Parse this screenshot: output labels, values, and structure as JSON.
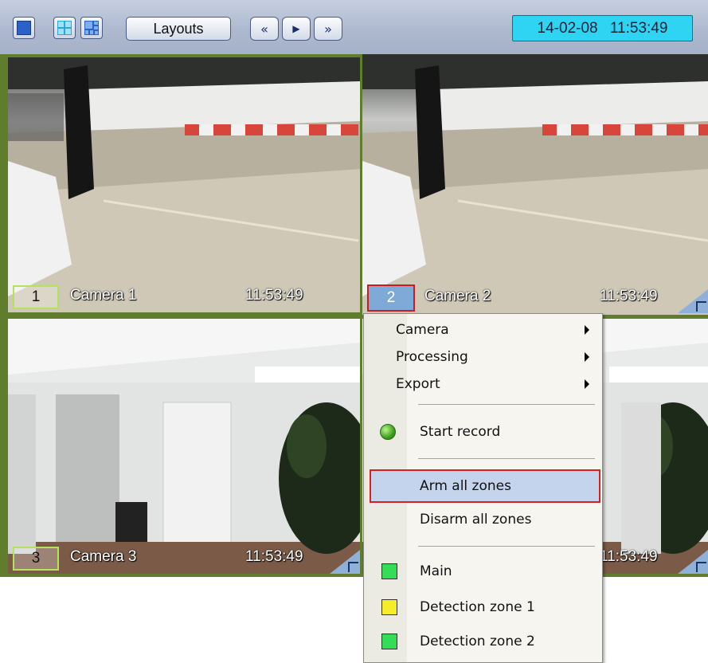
{
  "toolbar": {
    "layout_buttons": [
      "single-view",
      "quad-view",
      "multi-view"
    ],
    "layouts_label": "Layouts",
    "nav": {
      "prev": "«",
      "play": "▶",
      "next": "»"
    },
    "datetime": "14-02-08 11:53:49"
  },
  "cameras": [
    {
      "number": "1",
      "name": "Camera 1",
      "time": "11:53:49"
    },
    {
      "number": "2",
      "name": "Camera 2",
      "time": "11:53:49"
    },
    {
      "number": "3",
      "name": "Camera 3",
      "time": "11:53:49"
    },
    {
      "number": "",
      "name": "",
      "time": "11:53:49"
    }
  ],
  "context_menu": {
    "camera": "Camera",
    "processing": "Processing",
    "export": "Export",
    "start_record": "Start record",
    "arm_all_zones": "Arm all zones",
    "disarm_all_zones": "Disarm all zones",
    "zones": [
      {
        "label": "Main",
        "color": "#33dd55"
      },
      {
        "label": "Detection zone 1",
        "color": "#f5ec2a"
      },
      {
        "label": "Detection zone 2",
        "color": "#33dd55"
      }
    ]
  },
  "colors": {
    "active_border": "#8ed02c",
    "highlight_border": "#d82020",
    "datetime_bg": "#2fd4f2"
  }
}
